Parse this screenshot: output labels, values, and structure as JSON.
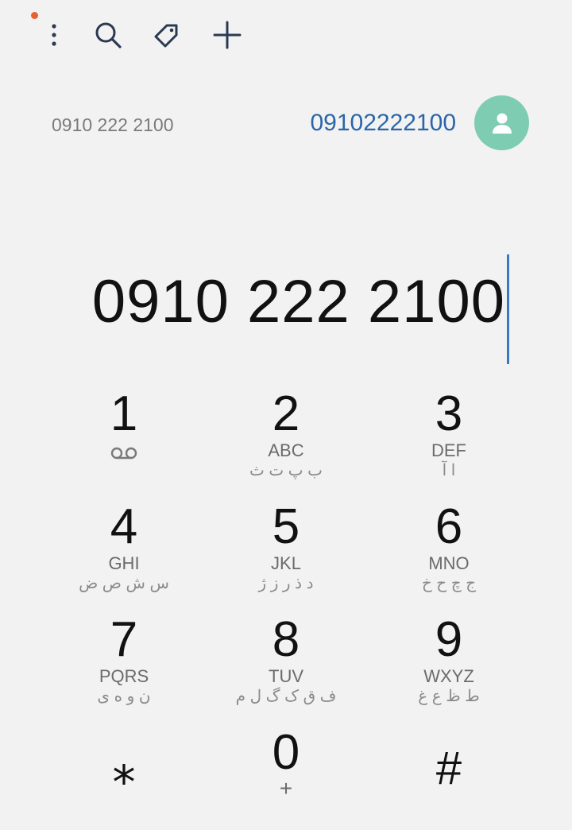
{
  "toolbar": {
    "notification_color": "#e8622f",
    "icons": [
      "more-options-icon",
      "search-icon",
      "tag-icon",
      "add-icon"
    ]
  },
  "suggestion": {
    "formatted": "0910 222 2100",
    "number": "09102222100",
    "avatar_color": "#7ecdb2"
  },
  "entry": {
    "number": "0910 222 2100",
    "cursor_color": "#3b78c4"
  },
  "keypad": {
    "keys": [
      {
        "digit": "1",
        "latin": "",
        "persian": ""
      },
      {
        "digit": "2",
        "latin": "ABC",
        "persian": "ب پ ت ث"
      },
      {
        "digit": "3",
        "latin": "DEF",
        "persian": "ا آ"
      },
      {
        "digit": "4",
        "latin": "GHI",
        "persian": "س ش ص ض"
      },
      {
        "digit": "5",
        "latin": "JKL",
        "persian": "د ذ ر ز ژ"
      },
      {
        "digit": "6",
        "latin": "MNO",
        "persian": "ج چ ح خ"
      },
      {
        "digit": "7",
        "latin": "PQRS",
        "persian": "ن و ه ی"
      },
      {
        "digit": "8",
        "latin": "TUV",
        "persian": "ف ق ک گ ل م"
      },
      {
        "digit": "9",
        "latin": "WXYZ",
        "persian": "ط ظ ع غ"
      },
      {
        "digit": "⁎",
        "latin": "",
        "persian": ""
      },
      {
        "digit": "0",
        "latin": "+",
        "persian": ""
      },
      {
        "digit": "#",
        "latin": "",
        "persian": ""
      }
    ],
    "voicemail_icon": "voicemail-icon"
  }
}
